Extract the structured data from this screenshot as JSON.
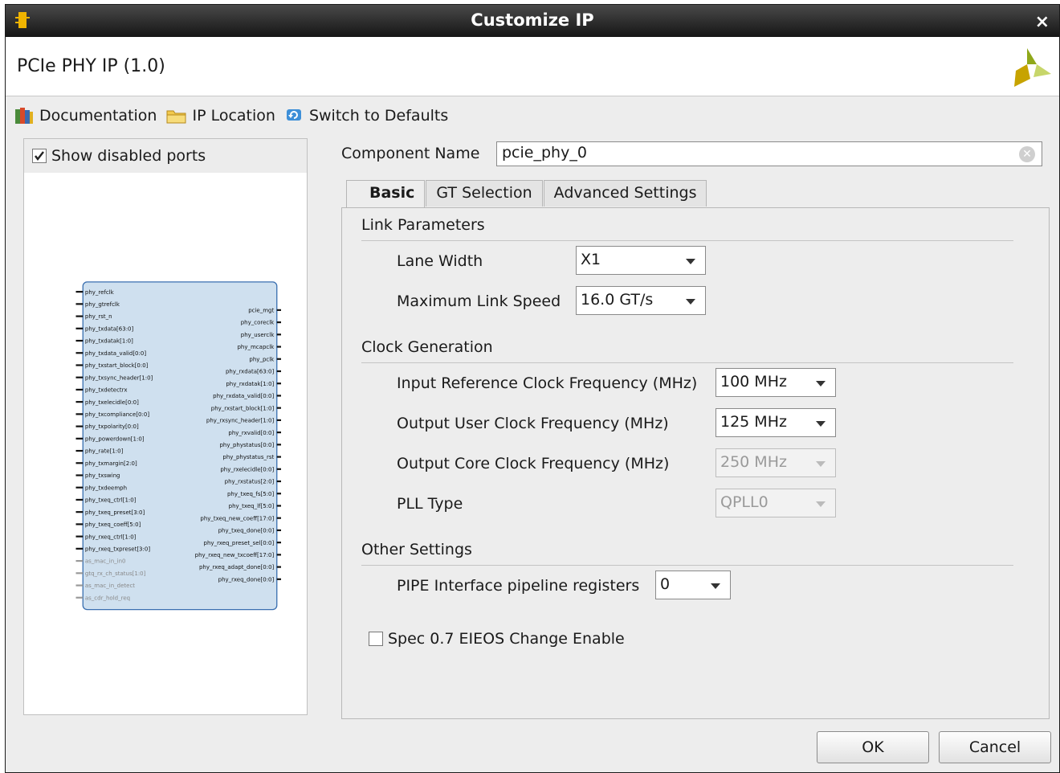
{
  "window": {
    "title": "Customize IP",
    "close_glyph": "×"
  },
  "header": {
    "ip_title": "PCIe PHY IP (1.0)",
    "logo_icon": "xilinx-logo-icon"
  },
  "toolbar": {
    "documentation": "Documentation",
    "ip_location": "IP Location",
    "switch_defaults": "Switch to Defaults"
  },
  "left_panel": {
    "show_disabled_ports": "Show disabled ports",
    "show_disabled_ports_checked": true,
    "left_ports": [
      "phy_refclk",
      "phy_gtrefclk",
      "phy_rst_n",
      "phy_txdata[63:0]",
      "phy_txdatak[1:0]",
      "phy_txdata_valid[0:0]",
      "phy_txstart_block[0:0]",
      "phy_txsync_header[1:0]",
      "phy_txdetectrx",
      "phy_txelecidle[0:0]",
      "phy_txcompliance[0:0]",
      "phy_txpolarity[0:0]",
      "phy_powerdown[1:0]",
      "phy_rate[1:0]",
      "phy_txmargin[2:0]",
      "phy_txswing",
      "phy_txdeemph",
      "phy_txeq_ctrl[1:0]",
      "phy_txeq_preset[3:0]",
      "phy_txeq_coeff[5:0]",
      "phy_rxeq_ctrl[1:0]",
      "phy_rxeq_txpreset[3:0]",
      "as_mac_in_in0",
      "gtq_rx_ch_status[1:0]",
      "as_mac_in_detect",
      "as_cdr_hold_req"
    ],
    "right_ports": [
      "pcie_mgt",
      "phy_coreclk",
      "phy_userclk",
      "phy_mcapclk",
      "phy_pclk",
      "phy_rxdata[63:0]",
      "phy_rxdatak[1:0]",
      "phy_rxdata_valid[0:0]",
      "phy_rxstart_block[1:0]",
      "phy_rxsync_header[1:0]",
      "phy_rxvalid[0:0]",
      "phy_phystatus[0:0]",
      "phy_phystatus_rst",
      "phy_rxelecidle[0:0]",
      "phy_rxstatus[2:0]",
      "phy_txeq_fs[5:0]",
      "phy_txeq_lf[5:0]",
      "phy_txeq_new_coeff[17:0]",
      "phy_txeq_done[0:0]",
      "phy_rxeq_preset_sel[0:0]",
      "phy_rxeq_new_txcoeff[17:0]",
      "phy_rxeq_adapt_done[0:0]",
      "phy_rxeq_done[0:0]"
    ]
  },
  "form": {
    "component_name_label": "Component Name",
    "component_name_value": "pcie_phy_0",
    "tabs": [
      "Basic",
      "GT Selection",
      "Advanced Settings"
    ],
    "active_tab": "Basic",
    "link_params": {
      "title": "Link Parameters",
      "lane_width_label": "Lane Width",
      "lane_width_value": "X1",
      "max_speed_label": "Maximum Link Speed",
      "max_speed_value": "16.0 GT/s"
    },
    "clock_gen": {
      "title": "Clock Generation",
      "ref_clk_label": "Input Reference Clock Frequency (MHz)",
      "ref_clk_value": "100 MHz",
      "user_clk_label": "Output User Clock Frequency (MHz)",
      "user_clk_value": "125 MHz",
      "core_clk_label": "Output Core Clock Frequency (MHz)",
      "core_clk_value": "250 MHz",
      "pll_label": "PLL Type",
      "pll_value": "QPLL0"
    },
    "other": {
      "title": "Other Settings",
      "pipe_label": "PIPE Interface pipeline registers",
      "pipe_value": "0",
      "spec_label": "Spec 0.7 EIEOS Change Enable",
      "spec_checked": false
    }
  },
  "buttons": {
    "ok": "OK",
    "cancel": "Cancel"
  },
  "colors": {
    "titlebar": "#1f1f1f",
    "symbol_fill": "#cfe0ef",
    "symbol_border": "#3a6fb0"
  }
}
